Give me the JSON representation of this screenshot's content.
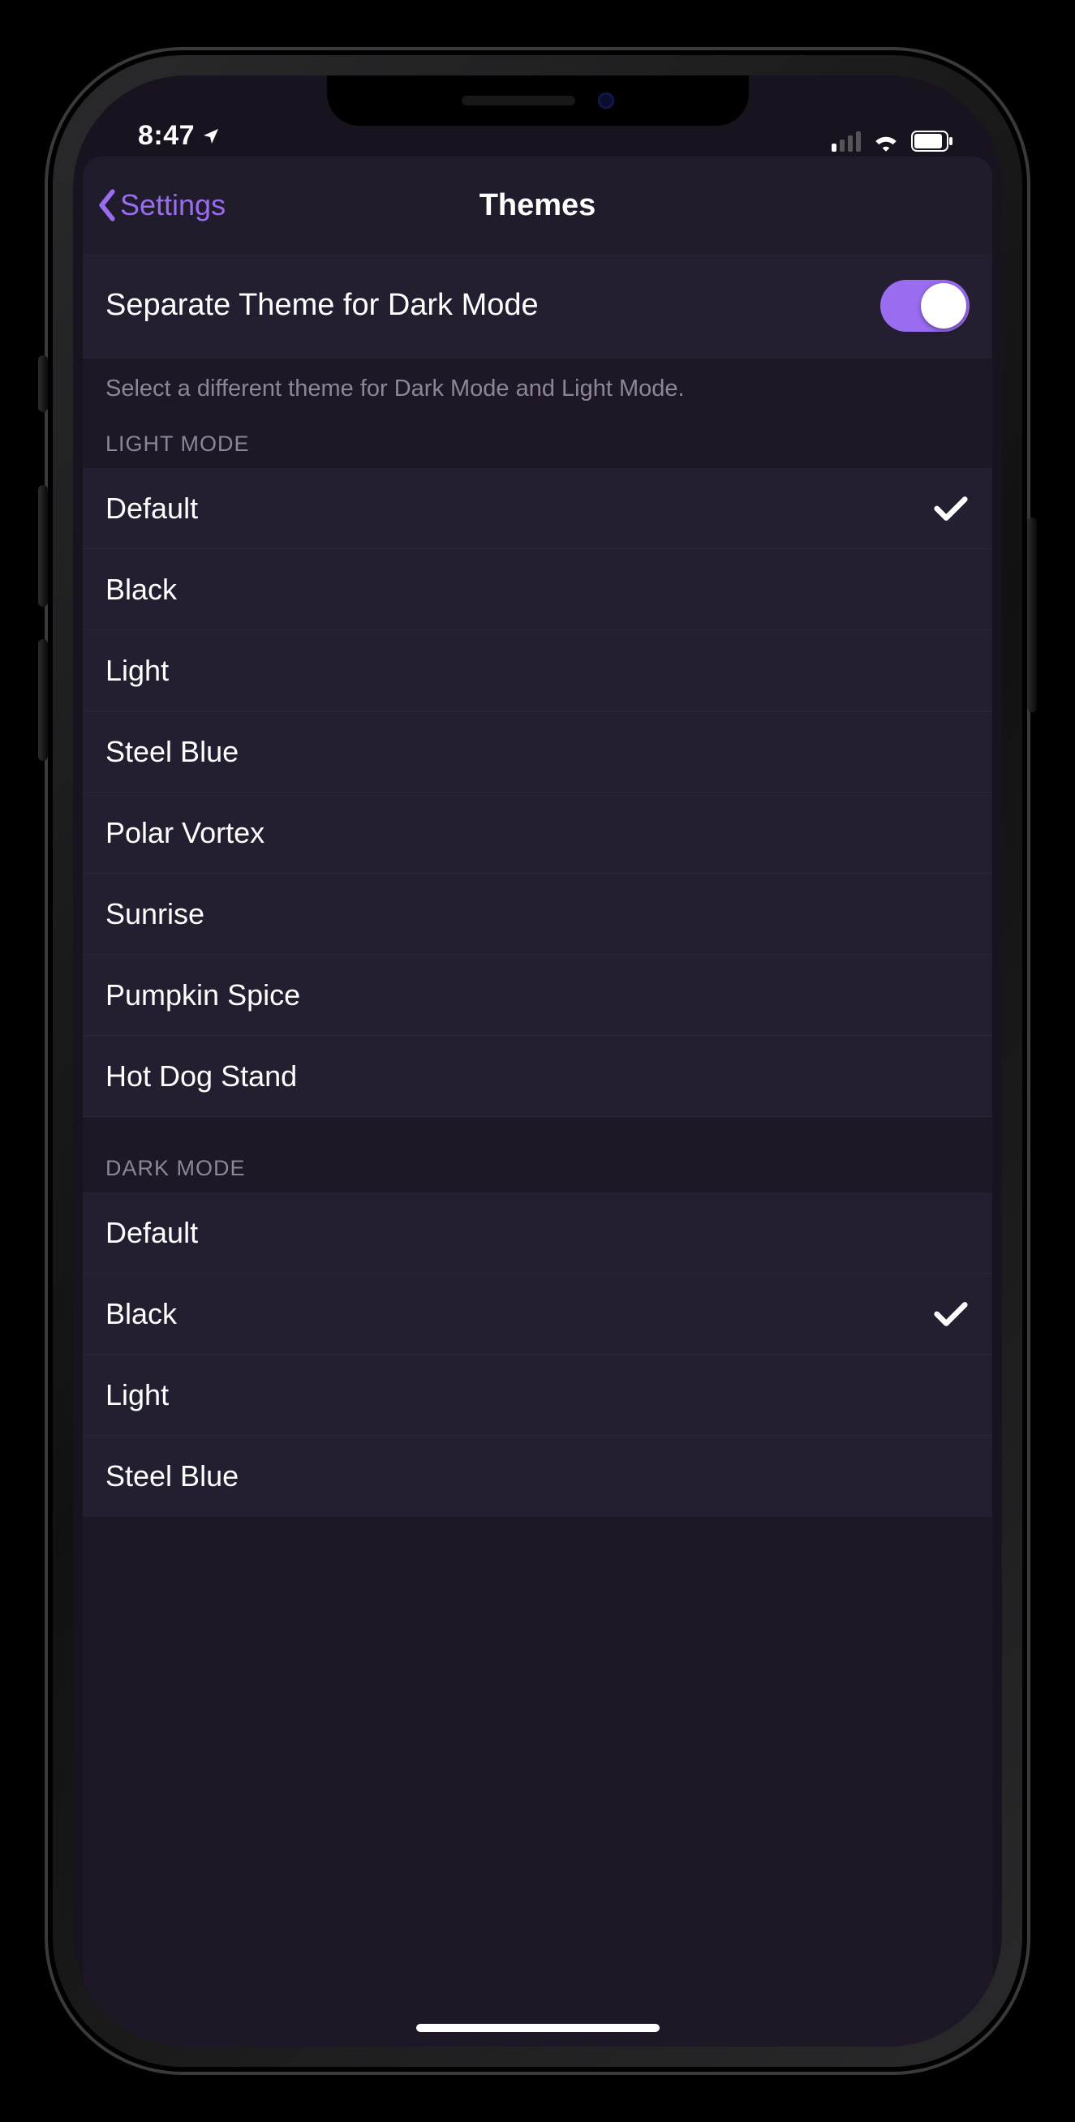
{
  "status_bar": {
    "time": "8:47"
  },
  "nav": {
    "back_label": "Settings",
    "title": "Themes"
  },
  "separate_mode": {
    "label": "Separate Theme for Dark Mode",
    "enabled": true,
    "footer": "Select a different theme for Dark Mode and Light Mode."
  },
  "sections": {
    "light": {
      "header": "Light Mode",
      "items": [
        {
          "label": "Default",
          "selected": true
        },
        {
          "label": "Black",
          "selected": false
        },
        {
          "label": "Light",
          "selected": false
        },
        {
          "label": "Steel Blue",
          "selected": false
        },
        {
          "label": "Polar Vortex",
          "selected": false
        },
        {
          "label": "Sunrise",
          "selected": false
        },
        {
          "label": "Pumpkin Spice",
          "selected": false
        },
        {
          "label": "Hot Dog Stand",
          "selected": false
        }
      ]
    },
    "dark": {
      "header": "Dark Mode",
      "items": [
        {
          "label": "Default",
          "selected": false
        },
        {
          "label": "Black",
          "selected": true
        },
        {
          "label": "Light",
          "selected": false
        },
        {
          "label": "Steel Blue",
          "selected": false
        }
      ]
    }
  }
}
